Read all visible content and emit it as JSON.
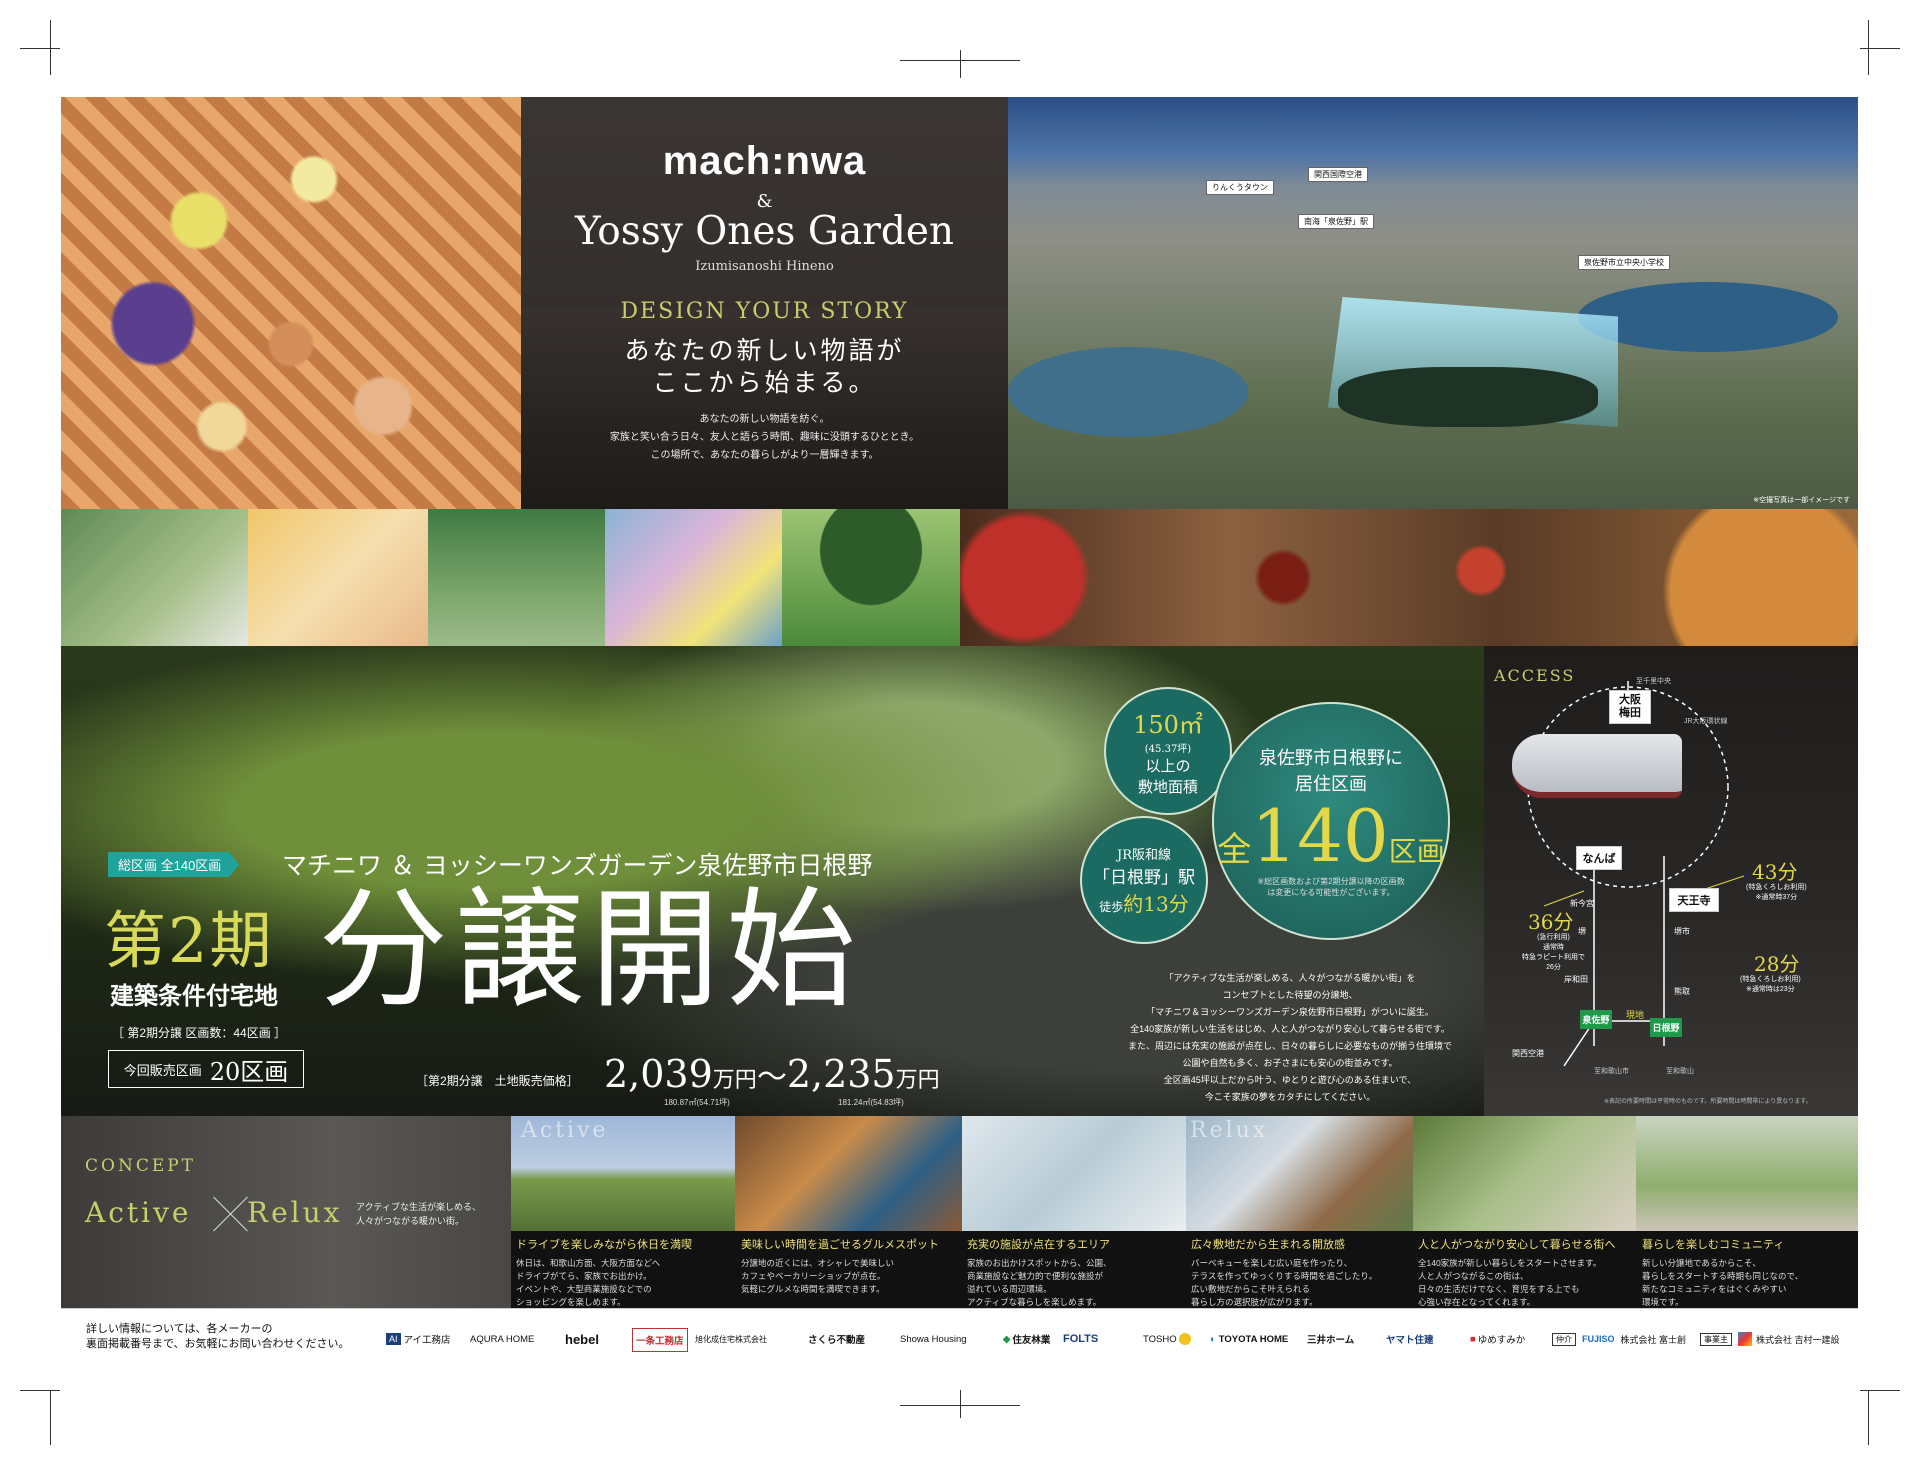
{
  "brand": {
    "logo_text": "mach:nwa",
    "amp": "&",
    "title": "Yossy Ones Garden",
    "subtitle": "Izumisanoshi Hineno"
  },
  "hero": {
    "tagline_en": "DESIGN YOUR STORY",
    "tagline_jp_1": "あなたの新しい物語が",
    "tagline_jp_2": "ここから始まる。",
    "body_1": "あなたの新しい物語を紡ぐ。",
    "body_2": "家族と笑い合う日々、友人と語らう時間、趣味に没頭するひととき。",
    "body_3": "この場所で、あなたの暮らしがより一層輝きます。"
  },
  "aerial": {
    "labels": [
      "りんくうタウン",
      "関西国際空港",
      "南海「泉佐野」駅",
      "泉佐野市立中央小学校"
    ],
    "note": "※空撮写真は一部イメージです"
  },
  "main": {
    "badge_label": "総区画 全140区画",
    "headline": "マチニワ ＆ ヨッシーワンズガーデン泉佐野市日根野",
    "phase": "第2期",
    "big_title": "分譲開始",
    "subtype": "建築条件付宅地",
    "phase_info": "［ 第2期分譲 区画数：44区画 ］",
    "current_label": "今回販売区画",
    "current_value": "20区画",
    "price_label": "［第2期分譲　土地販売価格］",
    "price_low": "2,039",
    "price_unit": "万円",
    "price_sep": "〜",
    "price_high": "2,235",
    "price_unit2": "万円",
    "area_low": "180.87㎡(54.71坪)",
    "area_high": "181.24㎡(54.83坪)"
  },
  "circles": {
    "area_value": "150㎡",
    "area_tsubo": "(45.37坪)",
    "area_label_1": "以上の",
    "area_label_2": "敷地面積",
    "station_line": "JR阪和線",
    "station_name": "「日根野」駅",
    "station_walk": "徒歩",
    "station_min": "約13分",
    "total_line1": "泉佐野市日根野に",
    "total_line2": "居住区画",
    "total_prefix": "全",
    "total_num": "140",
    "total_unit": "区画",
    "total_note": "※総区画数および第2期分譲以降の区画数は変更になる可能性がございます。"
  },
  "concept_text": {
    "lines": [
      "「アクティブな生活が楽しめる、人々がつながる暖かい街」を",
      "コンセプトとした待望の分譲地、",
      "「マチニワ＆ヨッシーワンズガーデン泉佐野市日根野」がついに誕生。",
      "全140家族が新しい生活をはじめ、人と人がつながり安心して暮らせる街です。",
      "また、周辺には充実の施設が点在し、日々の暮らしに必要なものが揃う住環境で",
      "公園や自然も多く、お子さまにも安心の街並みです。",
      "全区画45坪以上だから叶う、ゆとりと遊び心のある住まいで、",
      "今こそ家族の夢をカタチにしてください。"
    ]
  },
  "access": {
    "title": "ACCESS",
    "osaka": "大阪\n梅田",
    "namba": "なんば",
    "tennoji": "天王寺",
    "sakai": "堺",
    "sakaishi": "堺市",
    "shinimamiya": "新今宮",
    "kishiwada": "岸和田",
    "kumatori": "熊取",
    "izumisano": "泉佐野",
    "hineno": "日根野",
    "kix": "関西空港",
    "site": "現地",
    "wakayama1": "至和歌山市",
    "wakayama2": "至和歌山",
    "kyoto": "至千里中央",
    "loop": "JR大阪環状線",
    "t43": "43分",
    "t43_note": "(特急くろしお利用)\n※通常時37分",
    "t36": "36分",
    "t36_note": "(急行利用)\n通常時\n特急ラピート利用で\n26分",
    "t28": "28分",
    "t28_note": "(特急くろしお利用)\n※通常時は23分",
    "note": "※表記の所要時間は平常時のものです。所要時間は時間帯により異なります。"
  },
  "concept": {
    "title": "CONCEPT",
    "word1": "Active",
    "word2": "Relux",
    "desc": "アクティブな生活が楽しめる、人々がつながる暖かい街。",
    "overlay1": "Active",
    "overlay2": "Relux"
  },
  "strip": [
    {
      "title": "ドライブを楽しみながら休日を満喫",
      "body": "休日は、和歌山方面、大阪方面などへ\nドライブがてら、家族でお出かけ。\nイベントや、大型商業施設などでの\nショッピングを楽しめます。"
    },
    {
      "title": "美味しい時間を過ごせるグルメスポット",
      "body": "分譲地の近くには、オシャレで美味しい\nカフェやベーカリーショップが点在。\n気軽にグルメな時間を満喫できます。"
    },
    {
      "title": "充実の施設が点在するエリア",
      "body": "家族のお出かけスポットから、公園、\n商業施設など魅力的で便利な施設が\n溢れている周辺環境。\nアクティブな暮らしを楽しめます。"
    },
    {
      "title": "広々敷地だから生まれる開放感",
      "body": "バーベキューを楽しむ広い庭を作ったり、\nテラスを作ってゆっくりする時間を過ごしたり。\n広い敷地だからこそ叶えられる\n暮らし方の選択肢が広がります。"
    },
    {
      "title": "人と人がつながり安心して暮らせる街へ",
      "body": "全140家族が新しい暮らしをスタートさせます。\n人と人がつながるこの街は、\n日々の生活だけでなく、育児をする上でも\n心強い存在となってくれます。"
    },
    {
      "title": "暮らしを楽しむコミュニティ",
      "body": "新しい分譲地であるからこそ、\n暮らしをスタートする時期も同じなので、\n新たなコミュニティをはぐくみやすい\n環境です。"
    }
  ],
  "footer": {
    "contact": "詳しい情報については、各メーカーの\n裏面掲載番号まで、お気軽にお問い合わせください。",
    "logos": [
      "アイ工務店",
      "AQURA HOME",
      "hebel",
      "一条工務店",
      "旭化成住宅株式会社",
      "さくら不動産",
      "Showa Housing",
      "住友林業",
      "FOLTS",
      "TOSHO",
      "TOYOTA HOME",
      "三井ホーム",
      "ヤマト住建",
      "ゆめすみか"
    ],
    "broker_label": "仲介",
    "broker1": "FUJISO",
    "broker1b": "株式会社 富士創",
    "operator_label": "事業主",
    "operator": "株式会社 吉村一建設"
  },
  "colors": {
    "accent_gold": "#e3d74a",
    "accent_green": "#1f9a4a",
    "teal_circle": "#1c6b62",
    "badge_teal": "#1fa39a"
  }
}
